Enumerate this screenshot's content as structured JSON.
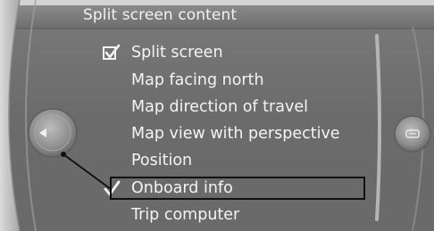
{
  "title": "Split screen content",
  "menu": {
    "items": [
      {
        "label": "Split screen",
        "checked": true,
        "check_style": "checkbox"
      },
      {
        "label": "Map facing north",
        "checked": false
      },
      {
        "label": "Map direction of travel",
        "checked": false
      },
      {
        "label": "Map view with perspective",
        "checked": false
      },
      {
        "label": "Position",
        "checked": false
      },
      {
        "label": "Onboard info",
        "checked": true,
        "check_style": "checkmark",
        "highlighted": true
      },
      {
        "label": "Trip computer",
        "checked": false
      }
    ]
  },
  "icons": {
    "left_knob": "back-arrow-icon",
    "right_knob": "options-icon"
  },
  "colors": {
    "panel": "#6e6e6e",
    "text": "#f4f4f4",
    "bezel": "#9a9a9a",
    "highlight_border": "#111111"
  }
}
